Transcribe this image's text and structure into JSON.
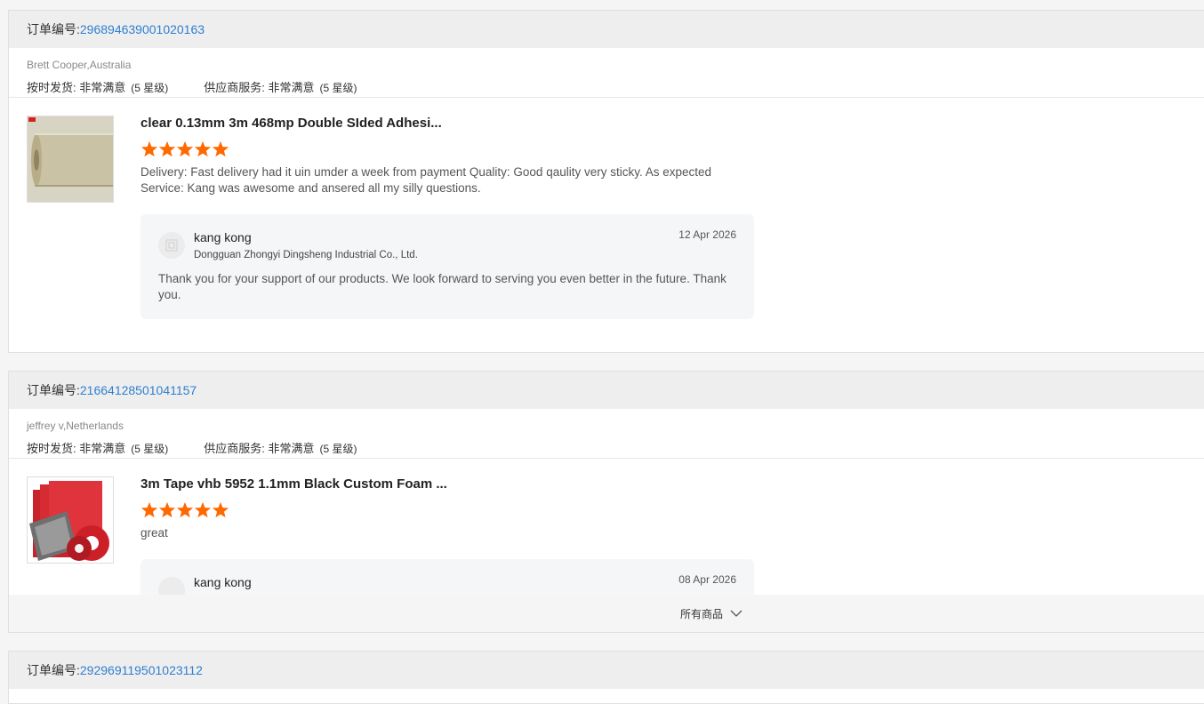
{
  "orders": [
    {
      "order_label": "订单编号:",
      "order_no": "296894639001020163",
      "buyer": "Brett Cooper,Australia",
      "ratings": [
        {
          "label": "按时发货: 非常满意",
          "level": "(5 星级)"
        },
        {
          "label": "供应商服务: 非常满意",
          "level": "(5 星级)"
        }
      ],
      "product": {
        "title": "clear 0.13mm 3m 468mp Double SIded Adhesi...",
        "stars": 5,
        "review": "Delivery:   Fast delivery had it uin umder a week from payment Quality:   Good qaulity very sticky. As expected Service:   Kang was awesome and ansered all my silly questions."
      },
      "reply": {
        "name": "kang kong",
        "company": "Dongguan Zhongyi Dingsheng Industrial Co., Ltd.",
        "date": "12 Apr 2026",
        "text": "Thank you for your support of our products. We look forward to serving you even better in the future. Thank you."
      }
    },
    {
      "order_label": "订单编号:",
      "order_no": "21664128501041157",
      "buyer": "jeffrey v,Netherlands",
      "ratings": [
        {
          "label": "按时发货: 非常满意",
          "level": "(5 星级)"
        },
        {
          "label": "供应商服务: 非常满意",
          "level": "(5 星级)"
        }
      ],
      "product": {
        "title": "3m Tape vhb 5952 1.1mm Black Custom Foam ...",
        "stars": 5,
        "review": "great"
      },
      "reply": {
        "name": "kang kong",
        "date": "08 Apr 2026"
      },
      "more_label": "所有商品"
    },
    {
      "order_label": "订单编号:",
      "order_no": "292969119501023112"
    }
  ],
  "colors": {
    "star": "#ff6a00",
    "link": "#2f7fd0"
  }
}
